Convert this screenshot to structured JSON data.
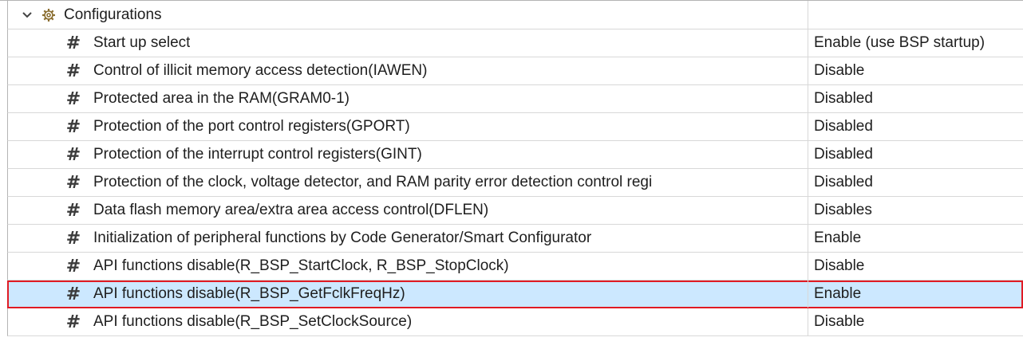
{
  "tree": {
    "root": {
      "label": "Configurations",
      "expand_icon": "chevron-down-icon",
      "node_icon": "gear-icon",
      "value": ""
    },
    "items": [
      {
        "label": "Start up select",
        "value": "Enable (use BSP startup)",
        "icon": "hash-icon"
      },
      {
        "label": "Control of illicit memory access detection(IAWEN)",
        "value": "Disable",
        "icon": "hash-icon"
      },
      {
        "label": "Protected area in the RAM(GRAM0-1)",
        "value": "Disabled",
        "icon": "hash-icon"
      },
      {
        "label": "Protection of the port control registers(GPORT)",
        "value": "Disabled",
        "icon": "hash-icon"
      },
      {
        "label": "Protection of the interrupt control registers(GINT)",
        "value": "Disabled",
        "icon": "hash-icon"
      },
      {
        "label": "Protection of the clock, voltage detector, and RAM parity error detection control regi",
        "value": "Disabled",
        "icon": "hash-icon"
      },
      {
        "label": "Data flash memory area/extra area access control(DFLEN)",
        "value": "Disables",
        "icon": "hash-icon"
      },
      {
        "label": "Initialization of peripheral functions by Code Generator/Smart Configurator",
        "value": "Enable",
        "icon": "hash-icon"
      },
      {
        "label": "API functions disable(R_BSP_StartClock, R_BSP_StopClock)",
        "value": "Disable",
        "icon": "hash-icon"
      },
      {
        "label": "API functions disable(R_BSP_GetFclkFreqHz)",
        "value": "Enable",
        "icon": "hash-icon"
      },
      {
        "label": "API functions disable(R_BSP_SetClockSource)",
        "value": "Disable",
        "icon": "hash-icon"
      }
    ],
    "selected_index": 9,
    "colors": {
      "selection_background": "#cce8ff",
      "selection_outline": "#e01b24",
      "grid_line": "#d8d8d8"
    }
  }
}
